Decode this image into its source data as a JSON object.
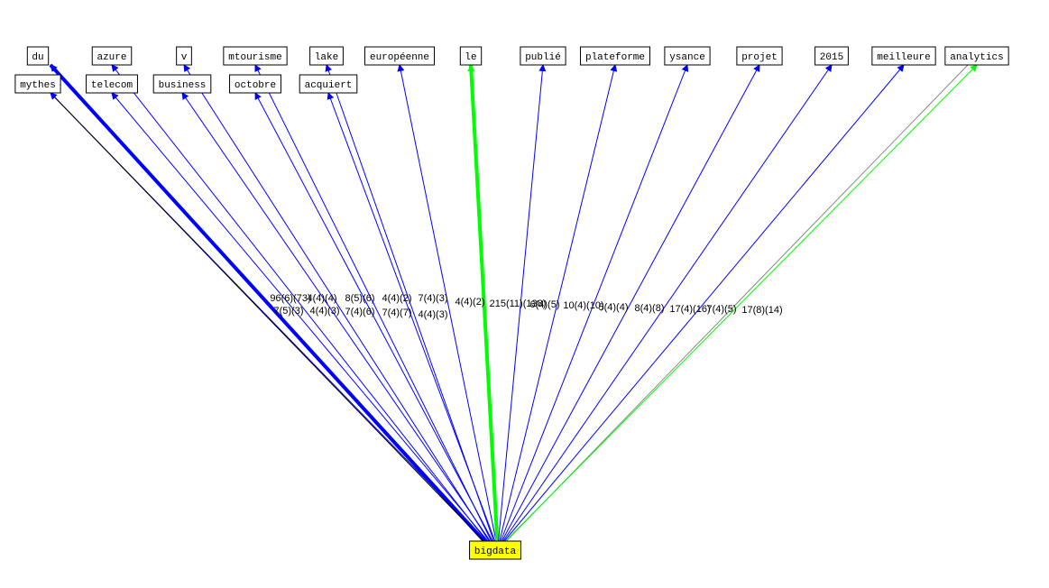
{
  "graph": {
    "center": {
      "label": "bigdata",
      "fill": "#ffff00"
    },
    "nodes": [
      {
        "id": "du",
        "label": "du"
      },
      {
        "id": "azure",
        "label": "azure"
      },
      {
        "id": "v",
        "label": "v"
      },
      {
        "id": "mtourisme",
        "label": "mtourisme"
      },
      {
        "id": "lake",
        "label": "lake"
      },
      {
        "id": "europeenne",
        "label": "européenne"
      },
      {
        "id": "le",
        "label": "le"
      },
      {
        "id": "publie",
        "label": "publié"
      },
      {
        "id": "plateforme",
        "label": "plateforme"
      },
      {
        "id": "ysance",
        "label": "ysance"
      },
      {
        "id": "projet",
        "label": "projet"
      },
      {
        "id": "2015",
        "label": "2015"
      },
      {
        "id": "meilleure",
        "label": "meilleure"
      },
      {
        "id": "analytics",
        "label": "analytics"
      },
      {
        "id": "mythes",
        "label": "mythes"
      },
      {
        "id": "telecom",
        "label": "telecom"
      },
      {
        "id": "business",
        "label": "business"
      },
      {
        "id": "octobre",
        "label": "octobre"
      },
      {
        "id": "acquiert",
        "label": "acquiert"
      }
    ],
    "edges": [
      {
        "to": "du",
        "color": "#0000ff",
        "weight": "heavy",
        "label": "96(6)(73)"
      },
      {
        "to": "mythes",
        "color": "#000000",
        "weight": "light",
        "label": "4(4)(4)"
      },
      {
        "to": "azure",
        "color": "#0000ff",
        "weight": "light",
        "label": "7(5)(3)"
      },
      {
        "to": "telecom",
        "color": "#0000ff",
        "weight": "light",
        "label": "4(4)(3)"
      },
      {
        "to": "v",
        "color": "#0000ff",
        "weight": "light",
        "label": "8(5)(6)"
      },
      {
        "to": "business",
        "color": "#0000ff",
        "weight": "light",
        "label": "7(4)(6)"
      },
      {
        "to": "mtourisme",
        "color": "#0000ff",
        "weight": "light",
        "label": "4(4)(2)"
      },
      {
        "to": "octobre",
        "color": "#0000ff",
        "weight": "light",
        "label": "7(4)(7)"
      },
      {
        "to": "lake",
        "color": "#0000ff",
        "weight": "light",
        "label": "7(4)(3)"
      },
      {
        "to": "acquiert",
        "color": "#0000ff",
        "weight": "light",
        "label": "4(4)(3)"
      },
      {
        "to": "europeenne",
        "color": "#0000ff",
        "weight": "light",
        "label": "4(4)(2)"
      },
      {
        "to": "le",
        "color": "#00ff00",
        "weight": "heavy",
        "label": "215(11)(138)"
      },
      {
        "to": "publie",
        "color": "#0000ff",
        "weight": "light",
        "label": "6(4)(5)"
      },
      {
        "to": "plateforme",
        "color": "#0000ff",
        "weight": "light",
        "label": "10(4)(10)"
      },
      {
        "to": "ysance",
        "color": "#0000ff",
        "weight": "light",
        "label": "5(4)(4)"
      },
      {
        "to": "projet",
        "color": "#0000ff",
        "weight": "light",
        "label": "8(4)(8)"
      },
      {
        "to": "2015",
        "color": "#0000ff",
        "weight": "light",
        "label": "17(4)(16)"
      },
      {
        "to": "meilleure",
        "color": "#0000ff",
        "weight": "light",
        "label": "7(4)(5)"
      },
      {
        "to": "analytics",
        "color": "#00ff00",
        "weight": "light",
        "label": "17(8)(14)"
      }
    ]
  }
}
